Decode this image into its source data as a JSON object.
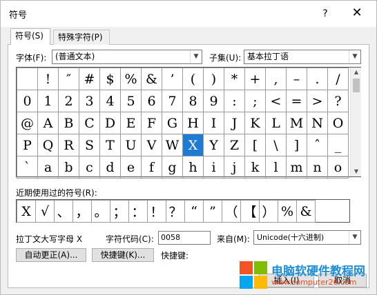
{
  "window": {
    "title": "符号",
    "help": "?",
    "close": "✕"
  },
  "tabs": [
    {
      "label": "符号(S)"
    },
    {
      "label": "特殊字符(P)"
    }
  ],
  "font": {
    "label": "字体(F):",
    "value": "(普通文本)"
  },
  "subset": {
    "label": "子集(U):",
    "value": "基本拉丁语"
  },
  "symbol_grid": [
    [
      " ",
      "!",
      "″",
      "#",
      "$",
      "%",
      "&",
      "’",
      "(",
      ")",
      "*",
      "+",
      ",",
      "–",
      ".",
      "/"
    ],
    [
      "0",
      "1",
      "2",
      "3",
      "4",
      "5",
      "6",
      "7",
      "8",
      "9",
      ":",
      ";",
      "<",
      "=",
      ">",
      "?"
    ],
    [
      "@",
      "A",
      "B",
      "C",
      "D",
      "E",
      "F",
      "G",
      "H",
      "I",
      "J",
      "K",
      "L",
      "M",
      "N",
      "O"
    ],
    [
      "P",
      "Q",
      "R",
      "S",
      "T",
      "U",
      "V",
      "W",
      "X",
      "Y",
      "Z",
      "[",
      "\\",
      "]",
      "ˆ",
      "_"
    ],
    [
      "`",
      "a",
      "b",
      "c",
      "d",
      "e",
      "f",
      "g",
      "h",
      "i",
      "j",
      "k",
      "l",
      "m",
      "n",
      "o"
    ]
  ],
  "selected": {
    "row": 3,
    "col": 8
  },
  "recent": {
    "label": "近期使用过的符号(R):",
    "symbols": [
      "X",
      "√",
      "、",
      "，",
      "。",
      "；",
      "：",
      "！",
      "？",
      "“",
      "”",
      "（",
      "【",
      "）",
      "%",
      "&"
    ]
  },
  "char_name": "拉丁文大写字母 X",
  "char_code": {
    "label": "字符代码(C):",
    "value": "0058"
  },
  "from": {
    "label": "来自(M):",
    "value": "Unicode(十六进制)"
  },
  "buttons": {
    "autocorrect": "自动更正(A)...",
    "shortcut_key": "快捷键(K)...",
    "shortcut_label": "快捷键:",
    "insert": "插入(I)",
    "cancel": "取消"
  },
  "watermark": {
    "line1": "电脑软硬件教程网",
    "line2": "www.computer26.com"
  },
  "colors": {
    "selection": "#1f7ad1",
    "wm_blue": "#1d8fd8",
    "wm_orange": "#e94b1f"
  }
}
